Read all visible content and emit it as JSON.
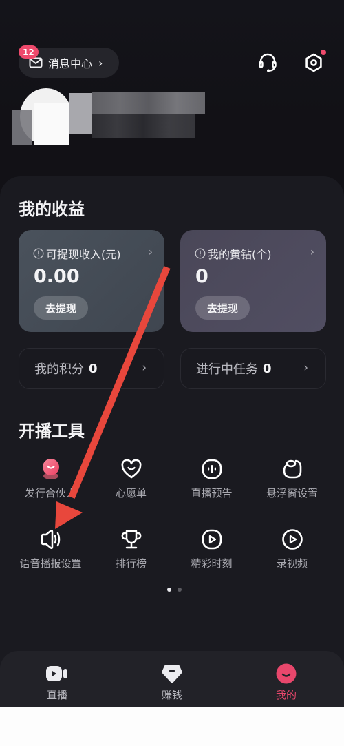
{
  "header": {
    "message_center": {
      "label": "消息中心",
      "badge_count": "12",
      "icon": "mail-icon"
    },
    "support_icon": "headset-icon",
    "settings_icon": "settings-hexagon-icon",
    "settings_has_notification": true
  },
  "profile": {
    "avatar": "avatar-blurred",
    "name": "(pixelated / obscured)"
  },
  "earnings": {
    "title": "我的收益",
    "cards": [
      {
        "label": "可提现收入(元)",
        "value": "0.00",
        "button": "去提现",
        "icon": "info-icon"
      },
      {
        "label": "我的黄钻(个)",
        "value": "0",
        "button": "去提现",
        "icon": "info-icon"
      }
    ],
    "stats": [
      {
        "label": "我的积分",
        "value": "0"
      },
      {
        "label": "进行中任务",
        "value": "0"
      }
    ]
  },
  "tools": {
    "title": "开播工具",
    "items": [
      {
        "label": "发行合伙人",
        "icon": "partner-orb-icon"
      },
      {
        "label": "心愿单",
        "icon": "heart-smile-icon"
      },
      {
        "label": "直播预告",
        "icon": "live-preview-icon"
      },
      {
        "label": "悬浮窗设置",
        "icon": "floating-window-icon"
      },
      {
        "label": "语音播报设置",
        "icon": "speaker-icon"
      },
      {
        "label": "排行榜",
        "icon": "trophy-icon"
      },
      {
        "label": "精彩时刻",
        "icon": "highlight-play-icon"
      },
      {
        "label": "录视频",
        "icon": "record-video-icon"
      }
    ],
    "pager": {
      "pages": 2,
      "current": 1
    }
  },
  "tabbar": {
    "items": [
      {
        "label": "直播",
        "icon": "video-camera-icon",
        "active": false
      },
      {
        "label": "赚钱",
        "icon": "diamond-coin-icon",
        "active": false
      },
      {
        "label": "我的",
        "icon": "smile-face-icon",
        "active": true
      }
    ],
    "active_color": "#e8476c"
  },
  "annotation": {
    "type": "arrow",
    "color": "#e8473c",
    "points_to": "语音播报设置"
  },
  "colors": {
    "accent": "#ef4a6c",
    "background": "#1a1a20"
  }
}
